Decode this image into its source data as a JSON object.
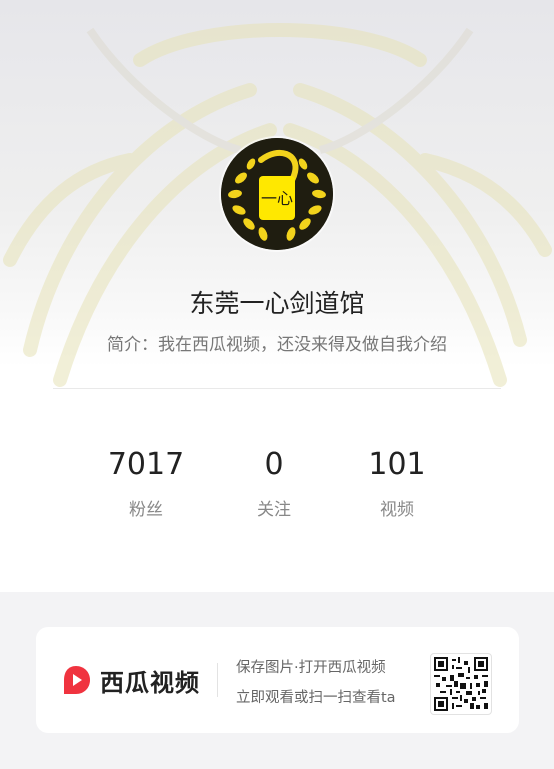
{
  "profile": {
    "name": "东莞一心剑道馆",
    "bio": "简介：我在西瓜视频，还没来得及做自我介绍",
    "avatar_text": "一心",
    "avatar_colors": {
      "ring": "#f2d31c",
      "center": "#ffe800",
      "dark": "#1f1d10"
    }
  },
  "stats": [
    {
      "value": "7017",
      "label": "粉丝"
    },
    {
      "value": "0",
      "label": "关注"
    },
    {
      "value": "101",
      "label": "视频"
    }
  ],
  "promo": {
    "brand_name": "西瓜视频",
    "brand_color": "#f0333f",
    "line1": "保存图片·打开西瓜视频",
    "line2": "立即观看或扫一扫查看ta",
    "qr_icon": "qr-code-icon"
  }
}
